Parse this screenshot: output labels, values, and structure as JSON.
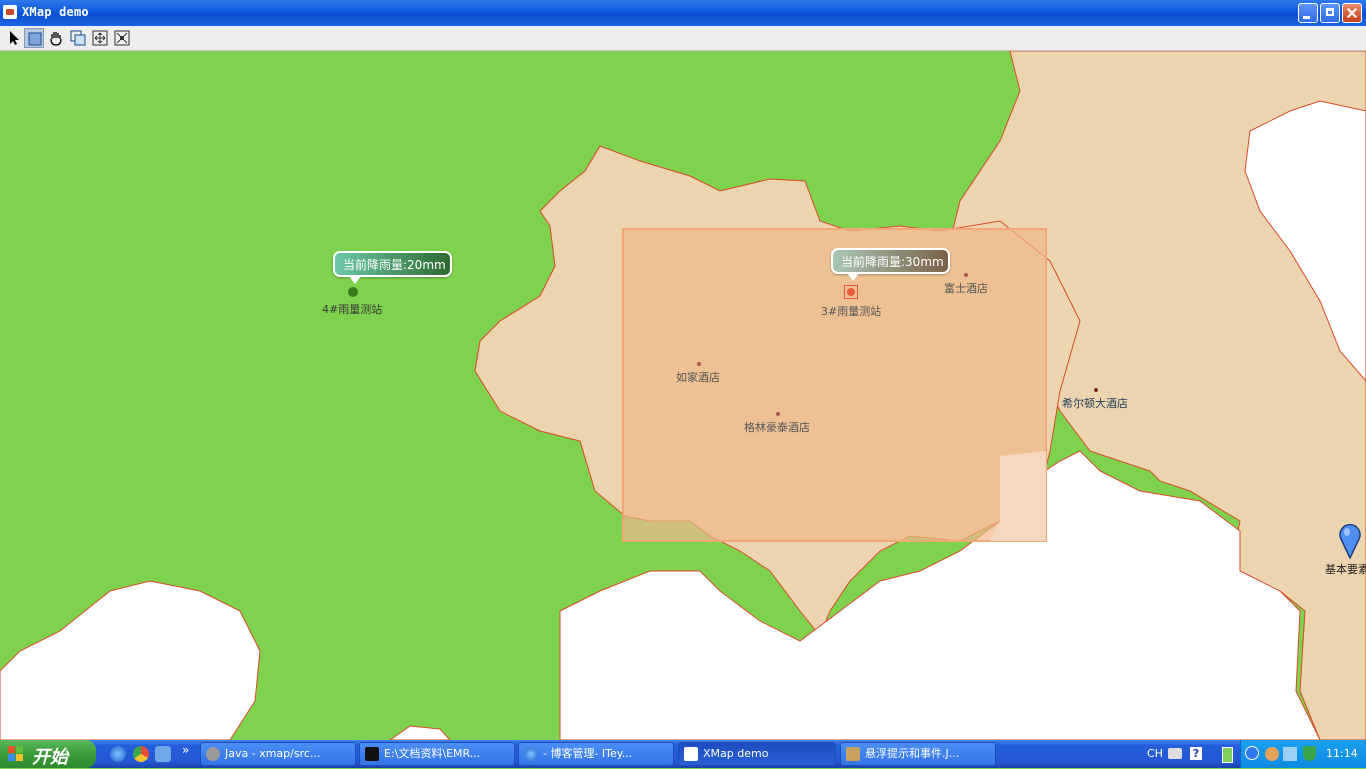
{
  "window": {
    "title": "XMap demo"
  },
  "toolbar": {
    "tools": [
      {
        "name": "select-tool"
      },
      {
        "name": "rectangle-select-tool"
      },
      {
        "name": "pan-tool"
      },
      {
        "name": "zoom-window-tool"
      },
      {
        "name": "full-extent-tool"
      },
      {
        "name": "zoom-fit-tool"
      }
    ]
  },
  "map": {
    "stations": [
      {
        "label": "4#雨量测站",
        "tooltip": "当前降雨量:20mm",
        "color": "#3a7d1f"
      },
      {
        "label": "3#雨量测站",
        "tooltip": "当前降雨量:30mm",
        "color": "#e85a3a"
      }
    ],
    "hotels": [
      "富士酒店",
      "如家酒店",
      "格林豪泰酒店",
      "希尔顿大酒店"
    ],
    "marker_label": "基本要素",
    "colors": {
      "green_region": "#7ed24d",
      "tan_region": "#ecd5ae",
      "selection": "#f0b88a",
      "border": "#d94a2a"
    }
  },
  "taskbar": {
    "start_label": "开始",
    "quick_launch": [
      "ie-icon",
      "chrome-icon",
      "refresh-icon"
    ],
    "more": "»",
    "buttons": [
      {
        "label": "Java - xmap/src...",
        "active": false
      },
      {
        "label": "E:\\文档资料\\EMR...",
        "active": false
      },
      {
        "label": "- 博客管理- ITey...",
        "active": false
      },
      {
        "label": "XMap demo",
        "active": true
      },
      {
        "label": "悬浮提示和事件.J...",
        "active": false
      }
    ],
    "lang": "CH",
    "clock": "11:14"
  }
}
